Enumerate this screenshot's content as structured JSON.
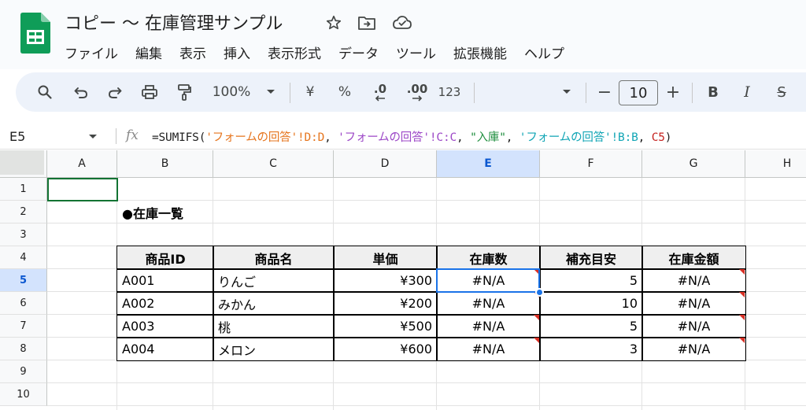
{
  "title_bar": {
    "doc_title": "コピー 〜 在庫管理サンプル",
    "icons": [
      "star-icon",
      "move-to-folder-icon",
      "cloud-saved-icon"
    ]
  },
  "menu": [
    "ファイル",
    "編集",
    "表示",
    "挿入",
    "表示形式",
    "データ",
    "ツール",
    "拡張機能",
    "ヘルプ"
  ],
  "toolbar": {
    "zoom": "100%",
    "currency": "¥",
    "percent": "%",
    "dec_decrease": ".0",
    "dec_increase": ".00",
    "number_format": "123",
    "font_size": "10",
    "minus": "−",
    "plus": "+",
    "bold": "B",
    "italic": "I",
    "strike": "S"
  },
  "formula_bar": {
    "cell_ref": "E5",
    "fx": "fx",
    "tokens": [
      {
        "text": "=SUMIFS(",
        "color": "#1f1f1f"
      },
      {
        "text": "'フォームの回答'!D:D",
        "color": "#e6751e"
      },
      {
        "text": ", ",
        "color": "#1f1f1f"
      },
      {
        "text": "'フォームの回答'!C:C",
        "color": "#9c47c7"
      },
      {
        "text": ", ",
        "color": "#1f1f1f"
      },
      {
        "text": "\"入庫\"",
        "color": "#1e8e3e"
      },
      {
        "text": ", ",
        "color": "#1f1f1f"
      },
      {
        "text": "'フォームの回答'!B:B",
        "color": "#11a5b5"
      },
      {
        "text": ", ",
        "color": "#1f1f1f"
      },
      {
        "text": "C5",
        "color": "#c5221f"
      },
      {
        "text": ")",
        "color": "#1f1f1f"
      }
    ]
  },
  "grid": {
    "columns": [
      "A",
      "B",
      "C",
      "D",
      "E",
      "F",
      "G",
      "H"
    ],
    "rows": [
      "1",
      "2",
      "3",
      "4",
      "5",
      "6",
      "7",
      "8",
      "9",
      "10"
    ],
    "active_cell": "E5",
    "section_title": "●在庫一覧",
    "table_headers": [
      "商品ID",
      "商品名",
      "単価",
      "在庫数",
      "補充目安",
      "在庫金額"
    ],
    "table_rows": [
      [
        "A001",
        "りんご",
        "¥300",
        "#N/A",
        "5",
        "#N/A"
      ],
      [
        "A002",
        "みかん",
        "¥200",
        "#N/A",
        "10",
        "#N/A"
      ],
      [
        "A003",
        "桃",
        "¥500",
        "#N/A",
        "5",
        "#N/A"
      ],
      [
        "A004",
        "メロン",
        "¥600",
        "#N/A",
        "3",
        "#N/A"
      ]
    ]
  },
  "colors": {
    "accent": "#1a73e8",
    "header_active": "#d3e3fd",
    "error_marker": "#d93025",
    "sheets_green": "#0f9d58"
  }
}
